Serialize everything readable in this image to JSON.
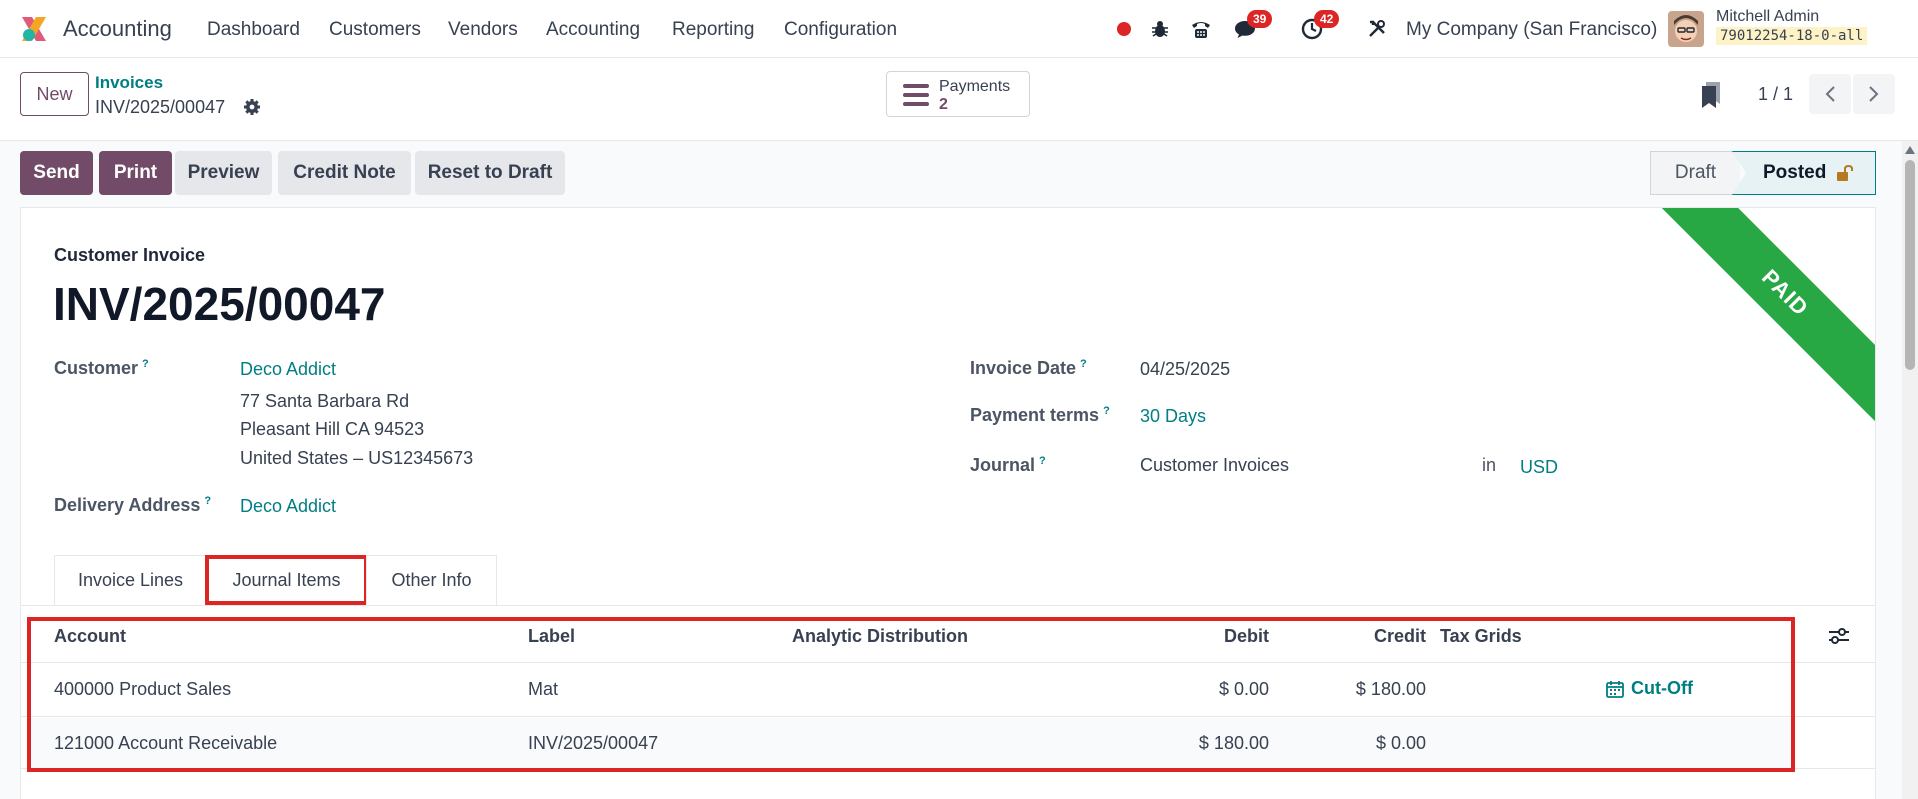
{
  "navbar": {
    "app_name": "Accounting",
    "menu": [
      "Dashboard",
      "Customers",
      "Vendors",
      "Accounting",
      "Reporting",
      "Configuration"
    ],
    "chat_badge": "39",
    "activity_badge": "42",
    "company": "My Company (San Francisco)",
    "user_name": "Mitchell Admin",
    "db_name": "79012254-18-0-all"
  },
  "control": {
    "new_label": "New",
    "breadcrumb_parent": "Invoices",
    "breadcrumb_current": "INV/2025/00047",
    "payments_label": "Payments",
    "payments_count": "2",
    "pager": "1 / 1"
  },
  "actions": {
    "send": "Send",
    "print": "Print",
    "preview": "Preview",
    "credit_note": "Credit Note",
    "reset_to_draft": "Reset to Draft"
  },
  "status": {
    "draft": "Draft",
    "posted": "Posted"
  },
  "ribbon": "PAID",
  "form": {
    "type_label": "Customer Invoice",
    "number": "INV/2025/00047",
    "customer_label": "Customer",
    "customer": "Deco Addict",
    "address_line1": "77 Santa Barbara Rd",
    "address_line2": "Pleasant Hill CA 94523",
    "address_line3": "United States – US12345673",
    "delivery_label": "Delivery Address",
    "delivery": "Deco Addict",
    "invoice_date_label": "Invoice Date",
    "invoice_date": "04/25/2025",
    "payment_terms_label": "Payment terms",
    "payment_terms": "30 Days",
    "journal_label": "Journal",
    "journal": "Customer Invoices",
    "in_label": "in",
    "currency": "USD",
    "help_mark": "?"
  },
  "tabs": [
    "Invoice Lines",
    "Journal Items",
    "Other Info"
  ],
  "table": {
    "headers": [
      "Account",
      "Label",
      "Analytic Distribution",
      "Debit",
      "Credit",
      "Tax Grids"
    ],
    "rows": [
      {
        "account": "400000 Product Sales",
        "label": "Mat",
        "analytic": "",
        "debit": "$ 0.00",
        "credit": "$ 180.00",
        "tax": "",
        "cutoff": "Cut-Off"
      },
      {
        "account": "121000 Account Receivable",
        "label": "INV/2025/00047",
        "analytic": "",
        "debit": "$ 180.00",
        "credit": "$ 0.00",
        "tax": "",
        "cutoff": ""
      }
    ]
  }
}
